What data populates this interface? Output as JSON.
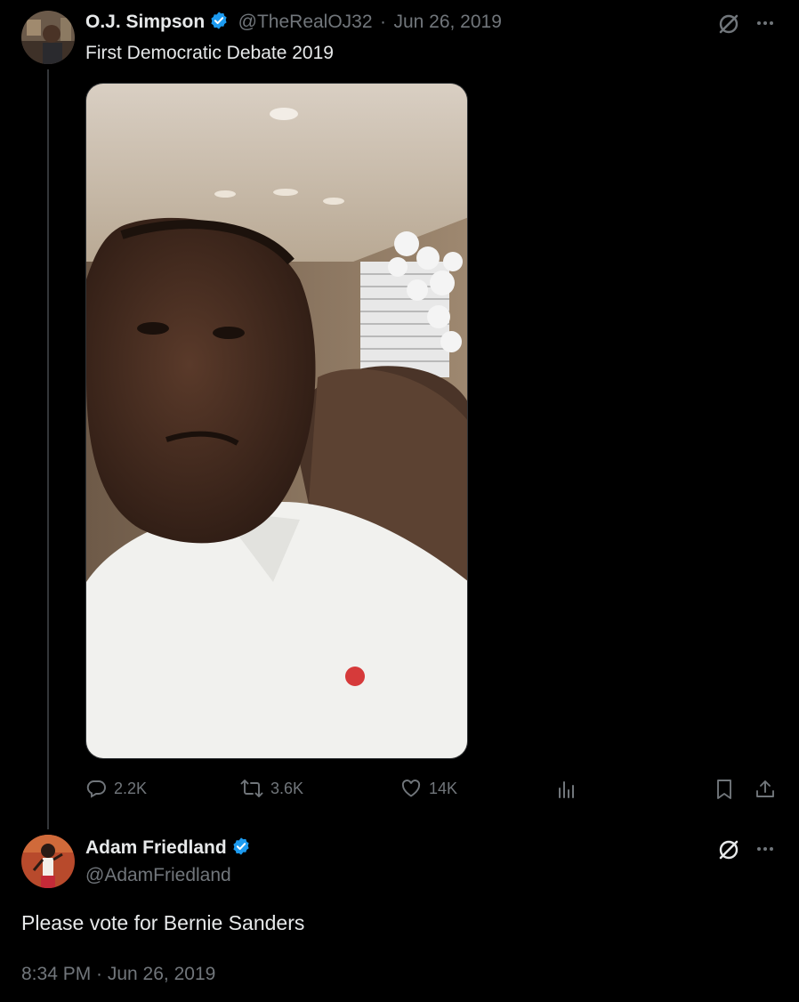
{
  "tweet": {
    "author_name": "O.J. Simpson",
    "author_handle": "@TheRealOJ32",
    "separator": "·",
    "date": "Jun 26, 2019",
    "text": "First Democratic Debate 2019",
    "actions": {
      "replies": "2.2K",
      "reposts": "3.6K",
      "likes": "14K"
    }
  },
  "reply": {
    "author_name": "Adam Friedland",
    "author_handle": "@AdamFriedland",
    "text": "Please vote for Bernie Sanders",
    "timestamp": "8:34 PM · Jun 26, 2019"
  },
  "colors": {
    "background": "#000000",
    "text": "#e7e9ea",
    "muted": "#71767b",
    "verified": "#1d9bf0",
    "thread_line": "#333639"
  },
  "icons": [
    "verified-badge-icon",
    "grok-icon",
    "more-icon",
    "reply-icon",
    "repost-icon",
    "like-icon",
    "views-icon",
    "bookmark-icon",
    "share-icon",
    "video-thumbnail"
  ]
}
